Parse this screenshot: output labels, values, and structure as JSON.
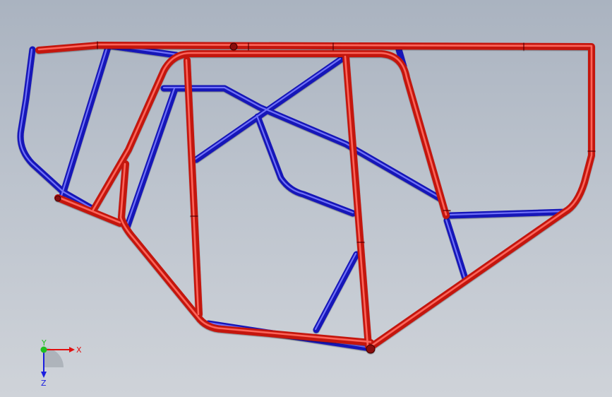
{
  "viewport": {
    "background_top": "#aab3c0",
    "background_bottom": "#cfd3d9"
  },
  "frame": {
    "primary_color": "#e8231e",
    "secondary_color": "#1a1ee0"
  },
  "triad": {
    "x_label": "X",
    "y_label": "Y",
    "z_label": "Z",
    "x_color": "#e01010",
    "y_color": "#20c020",
    "z_color": "#1a1ee0"
  }
}
